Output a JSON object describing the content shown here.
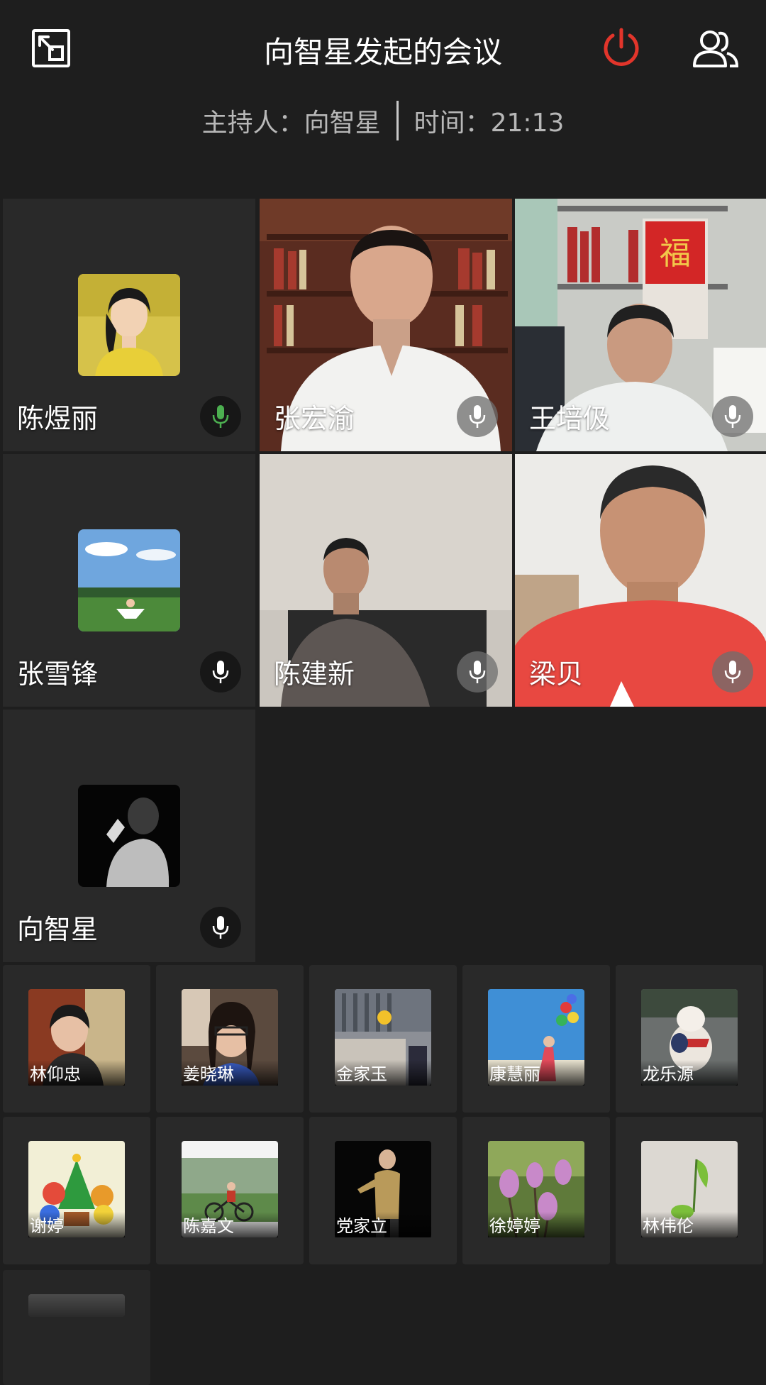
{
  "header": {
    "title": "向智星发起的会议",
    "host_label": "主持人：向智星",
    "time_label": "时间：21:13",
    "power_color": "#e2352b"
  },
  "tiles": [
    {
      "name": "陈煜丽",
      "kind": "avatar",
      "mic": "active",
      "mic_color": "#4caf50"
    },
    {
      "name": "张宏渝",
      "kind": "video",
      "mic": "idle"
    },
    {
      "name": "王培伋",
      "kind": "video",
      "mic": "idle"
    },
    {
      "name": "张雪锋",
      "kind": "avatar",
      "mic": "idle"
    },
    {
      "name": "陈建新",
      "kind": "video",
      "mic": "idle"
    },
    {
      "name": "梁贝",
      "kind": "video",
      "mic": "idle"
    },
    {
      "name": "向智星",
      "kind": "avatar",
      "mic": "idle"
    }
  ],
  "attendees": [
    {
      "name": "林仰忠"
    },
    {
      "name": "姜晓琳"
    },
    {
      "name": "金家玉"
    },
    {
      "name": "康慧丽"
    },
    {
      "name": "龙乐源"
    },
    {
      "name": "谢婷"
    },
    {
      "name": "陈嘉文"
    },
    {
      "name": "党家立"
    },
    {
      "name": "徐婷婷"
    },
    {
      "name": "林伟伦"
    }
  ],
  "icons": {
    "exit": "exit-fullscreen-icon",
    "power": "power-icon",
    "participants": "participants-icon",
    "mic": "microphone-icon"
  }
}
